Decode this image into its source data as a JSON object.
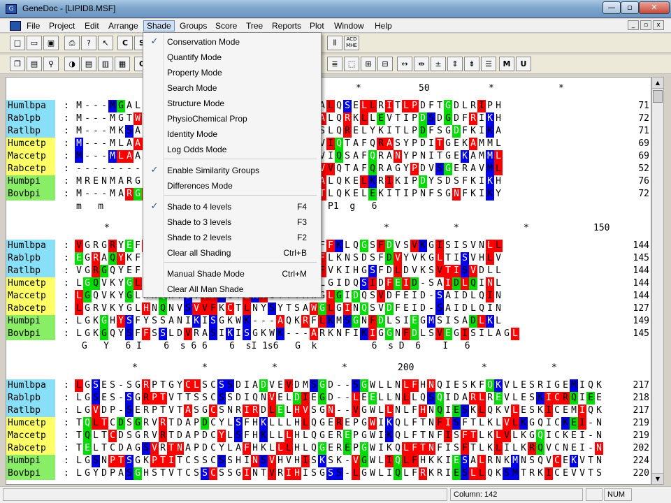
{
  "window": {
    "title": "GeneDoc - [LIPID8.MSF]",
    "app_icon": "genedoc-icon"
  },
  "menubar": {
    "items": [
      "File",
      "Project",
      "Edit",
      "Arrange",
      "Shade",
      "Groups",
      "Score",
      "Tree",
      "Reports",
      "Plot",
      "Window",
      "Help"
    ],
    "active": "Shade"
  },
  "toolbar1": [
    "new-icon",
    "open-icon",
    "save-icon",
    "print-icon",
    "help-icon",
    "context-help-icon",
    "C",
    "S"
  ],
  "toolbar1_right": [
    "ruler-icon",
    "acd-mhe-icon"
  ],
  "toolbar2": [
    "copy-icon",
    "paste-icon",
    "find-icon",
    "shade-icon",
    "shade2-icon",
    "shade3-icon",
    "shade4-icon",
    "C"
  ],
  "toolbar2_right": [
    "align-left-icon",
    "box-icon",
    "box2-icon",
    "box3-icon",
    "expand-icon",
    "collapse-icon",
    "tick-icon",
    "center-icon",
    "adjust-icon",
    "list-icon",
    "M",
    "U"
  ],
  "colors": {
    "red": "#ff0000",
    "green": "#00dd00",
    "blue": "#0000ee",
    "cyan": "#88e0f8",
    "yellow": "#ffff66",
    "lightgreen": "#88ee66",
    "menu_highlight": "#cfe0f4"
  },
  "shade_menu": {
    "items": [
      {
        "label": "Conservation Mode",
        "checked": true,
        "shortcut": ""
      },
      {
        "label": "Quantify Mode",
        "checked": false,
        "shortcut": ""
      },
      {
        "label": "Property Mode",
        "checked": false,
        "shortcut": ""
      },
      {
        "label": "Search Mode",
        "checked": false,
        "shortcut": ""
      },
      {
        "label": "Structure Mode",
        "checked": false,
        "shortcut": ""
      },
      {
        "label": "PhysioChemical Prop",
        "checked": false,
        "shortcut": ""
      },
      {
        "label": "Identity Mode",
        "checked": false,
        "shortcut": ""
      },
      {
        "label": "Log Odds Mode",
        "checked": false,
        "shortcut": ""
      },
      {
        "label": "Enable Similarity Groups",
        "checked": true,
        "shortcut": ""
      },
      {
        "label": "Differences Mode",
        "checked": false,
        "shortcut": ""
      },
      {
        "label": "Shade to 4 levels",
        "checked": true,
        "shortcut": "F4"
      },
      {
        "label": "Shade to 3 levels",
        "checked": false,
        "shortcut": "F3"
      },
      {
        "label": "Shade to 2 levels",
        "checked": false,
        "shortcut": "F2"
      },
      {
        "label": "Clear all Shading",
        "checked": false,
        "shortcut": "Ctrl+B"
      },
      {
        "label": "Manual Shade Mode",
        "checked": false,
        "shortcut": "Ctrl+M"
      },
      {
        "label": "Clear All Man Shade",
        "checked": false,
        "shortcut": ""
      }
    ]
  },
  "blocks": [
    {
      "ruler_marks": [
        "*",
        "50",
        "*",
        "*"
      ],
      "rows": [
        {
          "name": "Humlbpa",
          "name_bg": "cyan",
          "prefix": "M---MGALAR",
          "seq": "LVARITDKGLQYAAQEGLLALQSELLRITLPDFTGDLRIPH",
          "end": "71"
        },
        {
          "name": "Rablpb",
          "name_bg": "cyan",
          "prefix": "M---MGTWAR",
          "seq": "LITRITDKGLEYAARGGLLALQRKLLEVTIPDSDGDFRIKH",
          "end": "72"
        },
        {
          "name": "Ratlbp",
          "name_bg": "cyan",
          "prefix": "M---MKSATO",
          "seq": "MVVRITDKGLEYAAKEGLLSLQRELYKITLPDFSGDFKIKA",
          "end": "71"
        },
        {
          "name": "Humcetp",
          "name_bg": "yellow",
          "prefix": "M---MLAATV",
          "seq": "IVCRITKPALLVLNHETAKVIQTAFQRASYPDITGEKAMML",
          "end": "69"
        },
        {
          "name": "Maccetp",
          "name_bg": "yellow",
          "prefix": "M---MLAATV",
          "seq": "IVCRITKPALLVLNQETAKVIQSAFQRANYPNITGEKAMML",
          "end": "69"
        },
        {
          "name": "Rabcetp",
          "name_bg": "yellow",
          "prefix": "----------",
          "seq": "IVCRITKPALLVLNQETAKVVQTAFQRAGYPDVSGERAVML",
          "end": "52"
        },
        {
          "name": "Humbpi",
          "name_bg": "lightgreen",
          "prefix": "MRENMARGPC",
          "seq": "VVVRISQKGLDYASQQGTAALQKELKRIKIPDYSDSFKIKH",
          "end": "76"
        },
        {
          "name": "Bovbpi",
          "name_bg": "lightgreen",
          "prefix": "M---MARGPL",
          "seq": "IVARITDKGLDYACQQGVLTLQKELEKITIPNFSGNFKIKY",
          "end": "72"
        }
      ],
      "consensus": "m   m          66 RI3   L    2    6Q          P1  g   6"
    },
    {
      "ruler_marks": [
        "*",
        "*",
        "*",
        "*",
        "150"
      ],
      "rows": [
        {
          "name": "Humlbpa",
          "name_bg": "cyan",
          "prefix": "VGRGRYEFHS",
          "seq": "SDSSIRVQGRWK---VRKSFFKLQGSFDVSVKGISISVNLL",
          "end": "144"
        },
        {
          "name": "Rablpb",
          "name_bg": "cyan",
          "prefix": "EGRAQYKFYG",
          "seq": "SDAYIHVRGSWK---VRKAFLKNSDSFDVYVKGLTISVHLV",
          "end": "145"
        },
        {
          "name": "Ratlbp",
          "name_bg": "cyan",
          "prefix": "VGRGQYEFHS",
          "seq": "SDSSIRVRGKWK---VRKSFVKIHGSFDLDVKSVTISVDLL",
          "end": "144"
        },
        {
          "name": "Humcetp",
          "name_bg": "yellow",
          "prefix": "LGQVKYGLHN",
          "seq": "QNVSVVFKCTLKYGYTTAWLGIDQSIDFEID-SAIDLQINL",
          "end": "144"
        },
        {
          "name": "Maccetp",
          "name_bg": "yellow",
          "prefix": "LGQVKYGLHN",
          "seq": "QNVSVVFKCTLKYGYTTAWGLGIDQSVDFEID-SAIDLQIN",
          "end": "144"
        },
        {
          "name": "Rabcetp",
          "name_bg": "yellow",
          "prefix": "LGRVKYGLHN",
          "seq": "QNVSVVFKCTLNYSYTSAWGLGINQSVDFEID-SAIDLQIN",
          "end": "127"
        },
        {
          "name": "Humbpi",
          "name_bg": "lightgreen",
          "prefix": "LGKGHYSFYS",
          "seq": "SANIKISGKWK---AQKRFLKMSGNFDLSIEGMSISADLKL",
          "end": "149"
        },
        {
          "name": "Bovbpi",
          "name_bg": "lightgreen",
          "prefix": "LGKGQYSFFS",
          "seq": "SLDVRASIKISGKWK---ARKNFIKIGGNFDLSVEGISILAGL",
          "end": "145"
        }
      ],
      "consensus": " G   Y   6 I    6  s 6 6    6  sI 1s6   G  k          6  s D  6    I   6"
    },
    {
      "ruler_marks": [
        "*",
        "*",
        "*",
        "*",
        "200",
        "*",
        "*"
      ],
      "rows": [
        {
          "name": "Humlbpa",
          "name_bg": "cyan",
          "prefix": "LGSES-SGRP",
          "seq": "TGYCLSCSSDIADVEVDMSGD--SGWLLNLFHNQIESKFQKVLESRIGEMIQKSVSSDLQPYLQTL",
          "end": "217"
        },
        {
          "name": "Rablpb",
          "name_bg": "cyan",
          "prefix": "LGSES-SGRP",
          "seq": "TVTTSSCSSDIQNVELDIEGD--LEELLNLLQSQIDARLREVLESKICRQIEEAVTAHLQPYLQTL",
          "end": "218"
        },
        {
          "name": "Ratlbp",
          "name_bg": "cyan",
          "prefix": "LGVDP-SERP",
          "seq": "TVTASGCSNRIRDLELHVSGN--VGWLLNLFHNQIESKLQKVLESKICEMIQKSVTSDLQPYLQTL",
          "end": "217"
        },
        {
          "name": "Humcetp",
          "name_bg": "yellow",
          "prefix": "TQLTCDSGRV",
          "seq": "RTDAPDCYLSFHKLLLHLQGEREPGWIKQLFTNFISFTLKLVLKGQICKEI-NVISNIMADFVQTR",
          "end": "219"
        },
        {
          "name": "Maccetp",
          "name_bg": "yellow",
          "prefix": "TQLTCDSGRV",
          "seq": "RTDAPDCYLSFHKLLLHLQGEREPGWIKQLFTNFISFTLKLVLKGQICKEI-NIISNIMADFVQTR",
          "end": "219"
        },
        {
          "name": "Rabcetp",
          "name_bg": "yellow",
          "prefix": "TELTCDAGSV",
          "seq": "RTNAPDCYLAFHKLLLHLQGEREPGWIKQLFTNFISFTLKLILKRQVCNEI-NTISNIMADFVQTR",
          "end": "202"
        },
        {
          "name": "Humbpi",
          "name_bg": "lightgreen",
          "prefix": "LGSNPTSGKP",
          "seq": "TITCSSCSSHINSVHVHISKSK-VGWLIQLFHKKIESALRNKMNSQVCEKVTNSVSSKLQPYFQTL",
          "end": "224"
        },
        {
          "name": "Bovbpi",
          "name_bg": "lightgreen",
          "prefix": "LGYDPASGHS",
          "seq": "TVTCSSCSSGINTVRIHISGSS-LGWLIQLFRKRIESLLQKSMTRKICEVVTSTVSSKLQPYLQTL",
          "end": "220"
        }
      ],
      "consensus": ""
    }
  ],
  "status": {
    "left": "",
    "column": "Column: 142",
    "caps": "",
    "num": "NUM"
  }
}
